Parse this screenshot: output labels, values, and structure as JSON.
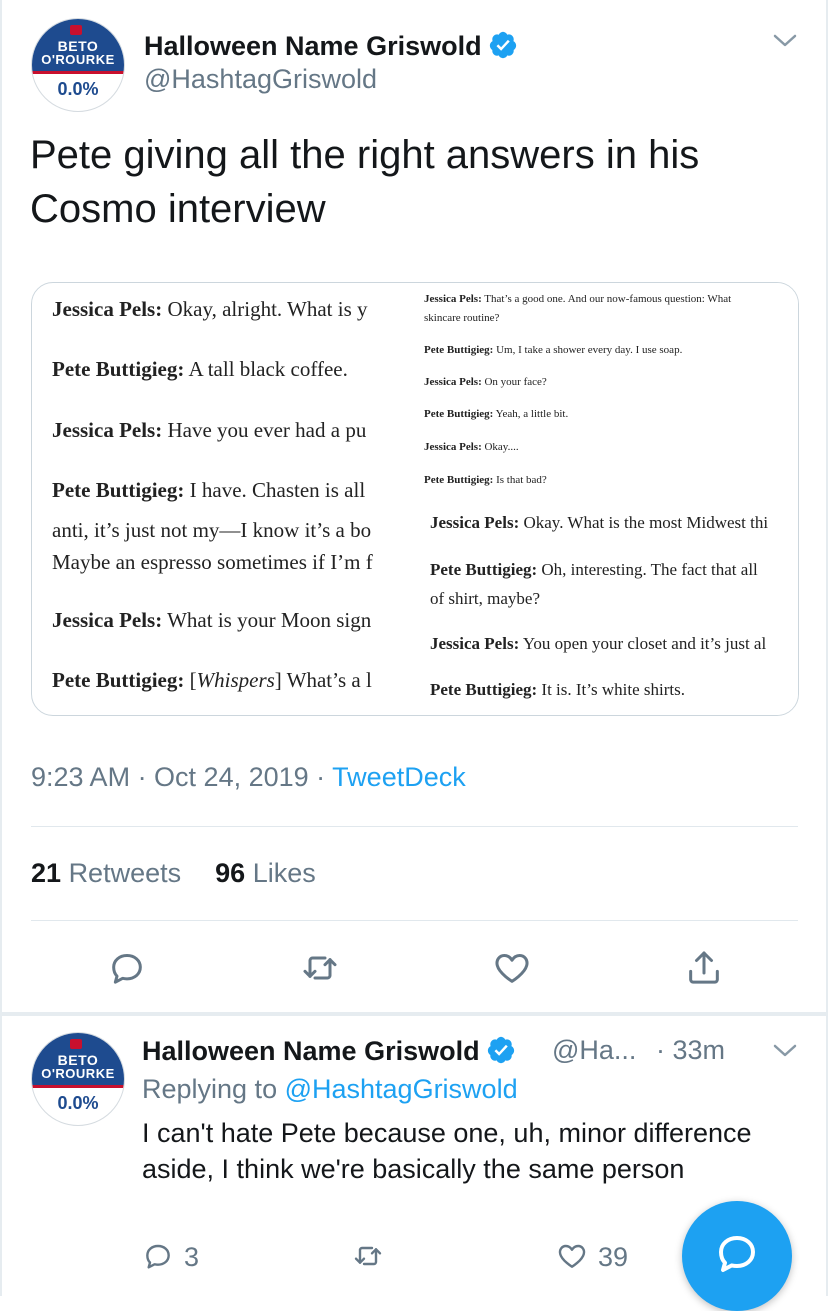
{
  "tweet": {
    "author_name": "Halloween Name Griswold",
    "handle": "@HashtagGriswold",
    "avatar": {
      "line1": "BETO",
      "line2": "O'ROURKE",
      "percent": "0.0%"
    },
    "text": "Pete giving all the right answers in his Cosmo interview",
    "timestamp": "9:23 AM · Oct 24, 2019 · ",
    "source": "TweetDeck",
    "retweets_count": "21",
    "retweets_label": "Retweets",
    "likes_count": "96",
    "likes_label": "Likes",
    "icons": [
      "reply-icon",
      "retweet-icon",
      "like-icon",
      "share-icon",
      "verified-icon",
      "chevron-down-icon"
    ]
  },
  "media": {
    "left": [
      {
        "speaker": "Jessica Pels:",
        "text": " Okay, alright. What is y"
      },
      {
        "speaker": "Pete Buttigieg:",
        "text": " A tall black coffee."
      },
      {
        "speaker": "Jessica Pels:",
        "text": " Have you ever had a pu"
      },
      {
        "speaker": "Pete Buttigieg:",
        "text": " I have. Chasten is all"
      },
      {
        "speaker": "",
        "text": "anti, it’s just not my—I know it’s a bo"
      },
      {
        "speaker": "",
        "text": "Maybe an espresso sometimes if I’m f"
      },
      {
        "speaker": "Jessica Pels:",
        "text": " What is your Moon sign"
      },
      {
        "speaker": "Pete Buttigieg:",
        "text": " [",
        "italic": "Whispers",
        "after": "] What’s a l"
      }
    ],
    "right_small": [
      {
        "speaker": "Jessica Pels:",
        "text": " That’s a good one. And our now-famous question: What"
      },
      {
        "speaker": "",
        "text": "skincare routine?"
      },
      {
        "speaker": "Pete Buttigieg:",
        "text": " Um, I take a shower every day. I use soap."
      },
      {
        "speaker": "Jessica Pels:",
        "text": " On your face?"
      },
      {
        "speaker": "Pete Buttigieg:",
        "text": " Yeah, a little bit."
      },
      {
        "speaker": "Jessica Pels:",
        "text": " Okay...."
      },
      {
        "speaker": "Pete Buttigieg:",
        "text": " Is that bad?"
      }
    ],
    "right_large": [
      {
        "speaker": "Jessica Pels:",
        "text": " Okay. What is the most Midwest thi"
      },
      {
        "speaker": "Pete Buttigieg:",
        "text": " Oh, interesting. The fact that all"
      },
      {
        "speaker": "",
        "text": "of shirt, maybe?"
      },
      {
        "speaker": "Jessica Pels:",
        "text": " You open your closet and it’s just al"
      },
      {
        "speaker": "Pete Buttigieg:",
        "text": " It is. It’s white shirts."
      }
    ]
  },
  "reply": {
    "author_name": "Halloween Name Griswold",
    "handle": "@Ha...",
    "time": "· 33m",
    "replying_prefix": "Replying to ",
    "replying_to": "@HashtagGriswold",
    "text": "I can't hate Pete because one, uh, minor difference aside, I think we're basically the same person",
    "reply_count": "3",
    "like_count": "39"
  },
  "colors": {
    "accent": "#1da1f2",
    "secondary_text": "#657786",
    "primary_text": "#14171a",
    "border": "#e1e8ed"
  }
}
